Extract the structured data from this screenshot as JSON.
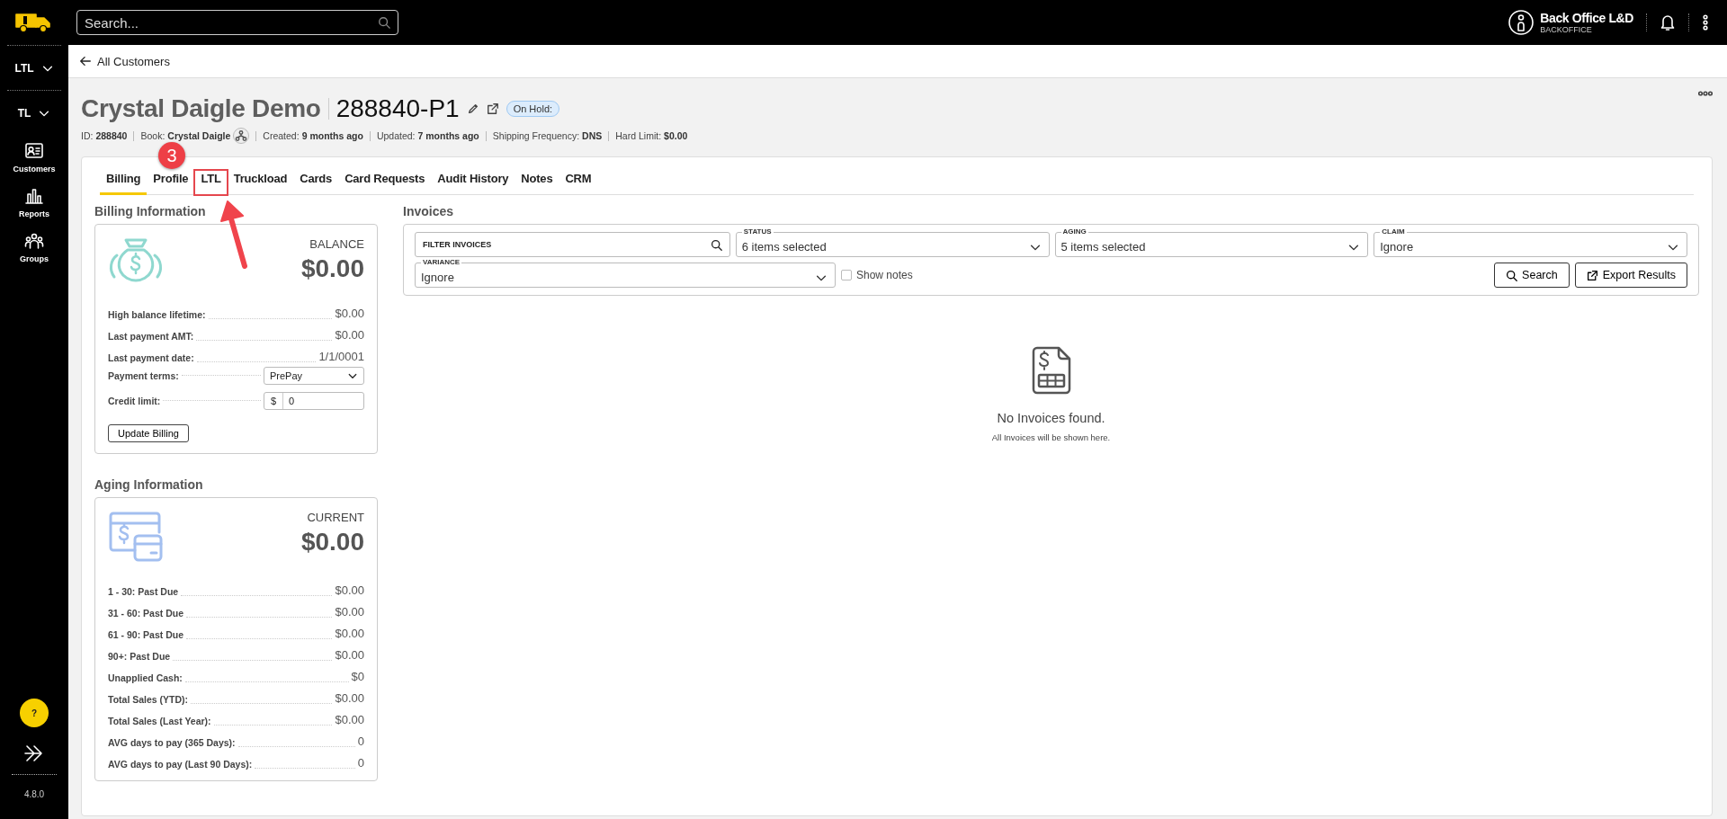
{
  "top_bar": {
    "search": {
      "placeholder": "Search..."
    },
    "user": {
      "name": "Back Office L&D",
      "role": "BACKOFFICE"
    }
  },
  "sidebar": {
    "menus": [
      {
        "label": "LTL"
      },
      {
        "label": "TL"
      }
    ],
    "items": [
      {
        "label": "Customers"
      },
      {
        "label": "Reports"
      },
      {
        "label": "Groups"
      }
    ],
    "help": "?",
    "version": "4.8.0"
  },
  "breadcrumb": {
    "label": "All Customers"
  },
  "customer": {
    "name": "Crystal Daigle Demo",
    "number": "288840-P1",
    "status": "On Hold:",
    "meta": [
      {
        "label": "ID:",
        "value": "288840",
        "kind": "plain"
      },
      {
        "label": "Book:",
        "value": "Crystal Daigle",
        "kind": "book"
      },
      {
        "label": "Created:",
        "value": "9 months ago",
        "kind": "plain"
      },
      {
        "label": "Updated:",
        "value": "7 months ago",
        "kind": "plain"
      },
      {
        "label": "Shipping Frequency:",
        "value": "DNS",
        "kind": "plain"
      },
      {
        "label": "Hard Limit:",
        "value": "$0.00",
        "kind": "plain"
      }
    ]
  },
  "tabs": [
    {
      "label": "Billing",
      "selected": true,
      "highlighted": false
    },
    {
      "label": "Profile",
      "selected": false,
      "highlighted": false
    },
    {
      "label": "LTL",
      "selected": false,
      "highlighted": true
    },
    {
      "label": "Truckload",
      "selected": false,
      "highlighted": false
    },
    {
      "label": "Cards",
      "selected": false,
      "highlighted": false
    },
    {
      "label": "Card Requests",
      "selected": false,
      "highlighted": false
    },
    {
      "label": "Audit History",
      "selected": false,
      "highlighted": false
    },
    {
      "label": "Notes",
      "selected": false,
      "highlighted": false
    },
    {
      "label": "CRM",
      "selected": false,
      "highlighted": false
    }
  ],
  "callout": {
    "number": "3"
  },
  "billing": {
    "title": "Billing Information",
    "total_label": "BALANCE",
    "total": "$0.00",
    "rows": [
      {
        "kind": "text",
        "label": "High balance lifetime:",
        "value": "$0.00"
      },
      {
        "kind": "text",
        "label": "Last payment AMT:",
        "value": "$0.00"
      },
      {
        "kind": "text",
        "label": "Last payment date:",
        "value": "1/1/0001"
      },
      {
        "kind": "select",
        "label": "Payment terms:",
        "value": "PrePay"
      },
      {
        "kind": "input",
        "label": "Credit limit:",
        "prefix": "$",
        "value": "0"
      }
    ],
    "button": "Update Billing"
  },
  "aging": {
    "title": "Aging Information",
    "total_label": "CURRENT",
    "total": "$0.00",
    "rows": [
      {
        "kind": "text",
        "label": "1 - 30: Past Due",
        "value": "$0.00"
      },
      {
        "kind": "text",
        "label": "31 - 60: Past Due",
        "value": "$0.00"
      },
      {
        "kind": "text",
        "label": "61 - 90: Past Due",
        "value": "$0.00"
      },
      {
        "kind": "text",
        "label": "90+: Past Due",
        "value": "$0.00"
      },
      {
        "kind": "text",
        "label": "Unapplied Cash:",
        "value": "$0"
      },
      {
        "kind": "text",
        "label": "Total Sales (YTD):",
        "value": "$0.00"
      },
      {
        "kind": "text",
        "label": "Total Sales (Last Year):",
        "value": "$0.00"
      },
      {
        "kind": "text",
        "label": "AVG days to pay (365 Days):",
        "value": "0"
      },
      {
        "kind": "text",
        "label": "AVG days to pay (Last 90 Days):",
        "value": "0"
      }
    ]
  },
  "invoices": {
    "title": "Invoices",
    "filter": {
      "placeholder": "FILTER INVOICES"
    },
    "selects": [
      {
        "label": "STATUS",
        "value": "6 items selected"
      },
      {
        "label": "AGING",
        "value": "5 items selected"
      },
      {
        "label": "CLAIM",
        "value": "Ignore"
      },
      {
        "label": "VARIANCE",
        "value": "Ignore"
      }
    ],
    "show_notes": {
      "label": "Show notes",
      "checked": false
    },
    "buttons": [
      {
        "label": "Search",
        "kind": "search"
      },
      {
        "label": "Export Results",
        "kind": "export"
      }
    ],
    "empty": {
      "title": "No Invoices found.",
      "subtitle": "All Invoices will be shown here."
    }
  }
}
